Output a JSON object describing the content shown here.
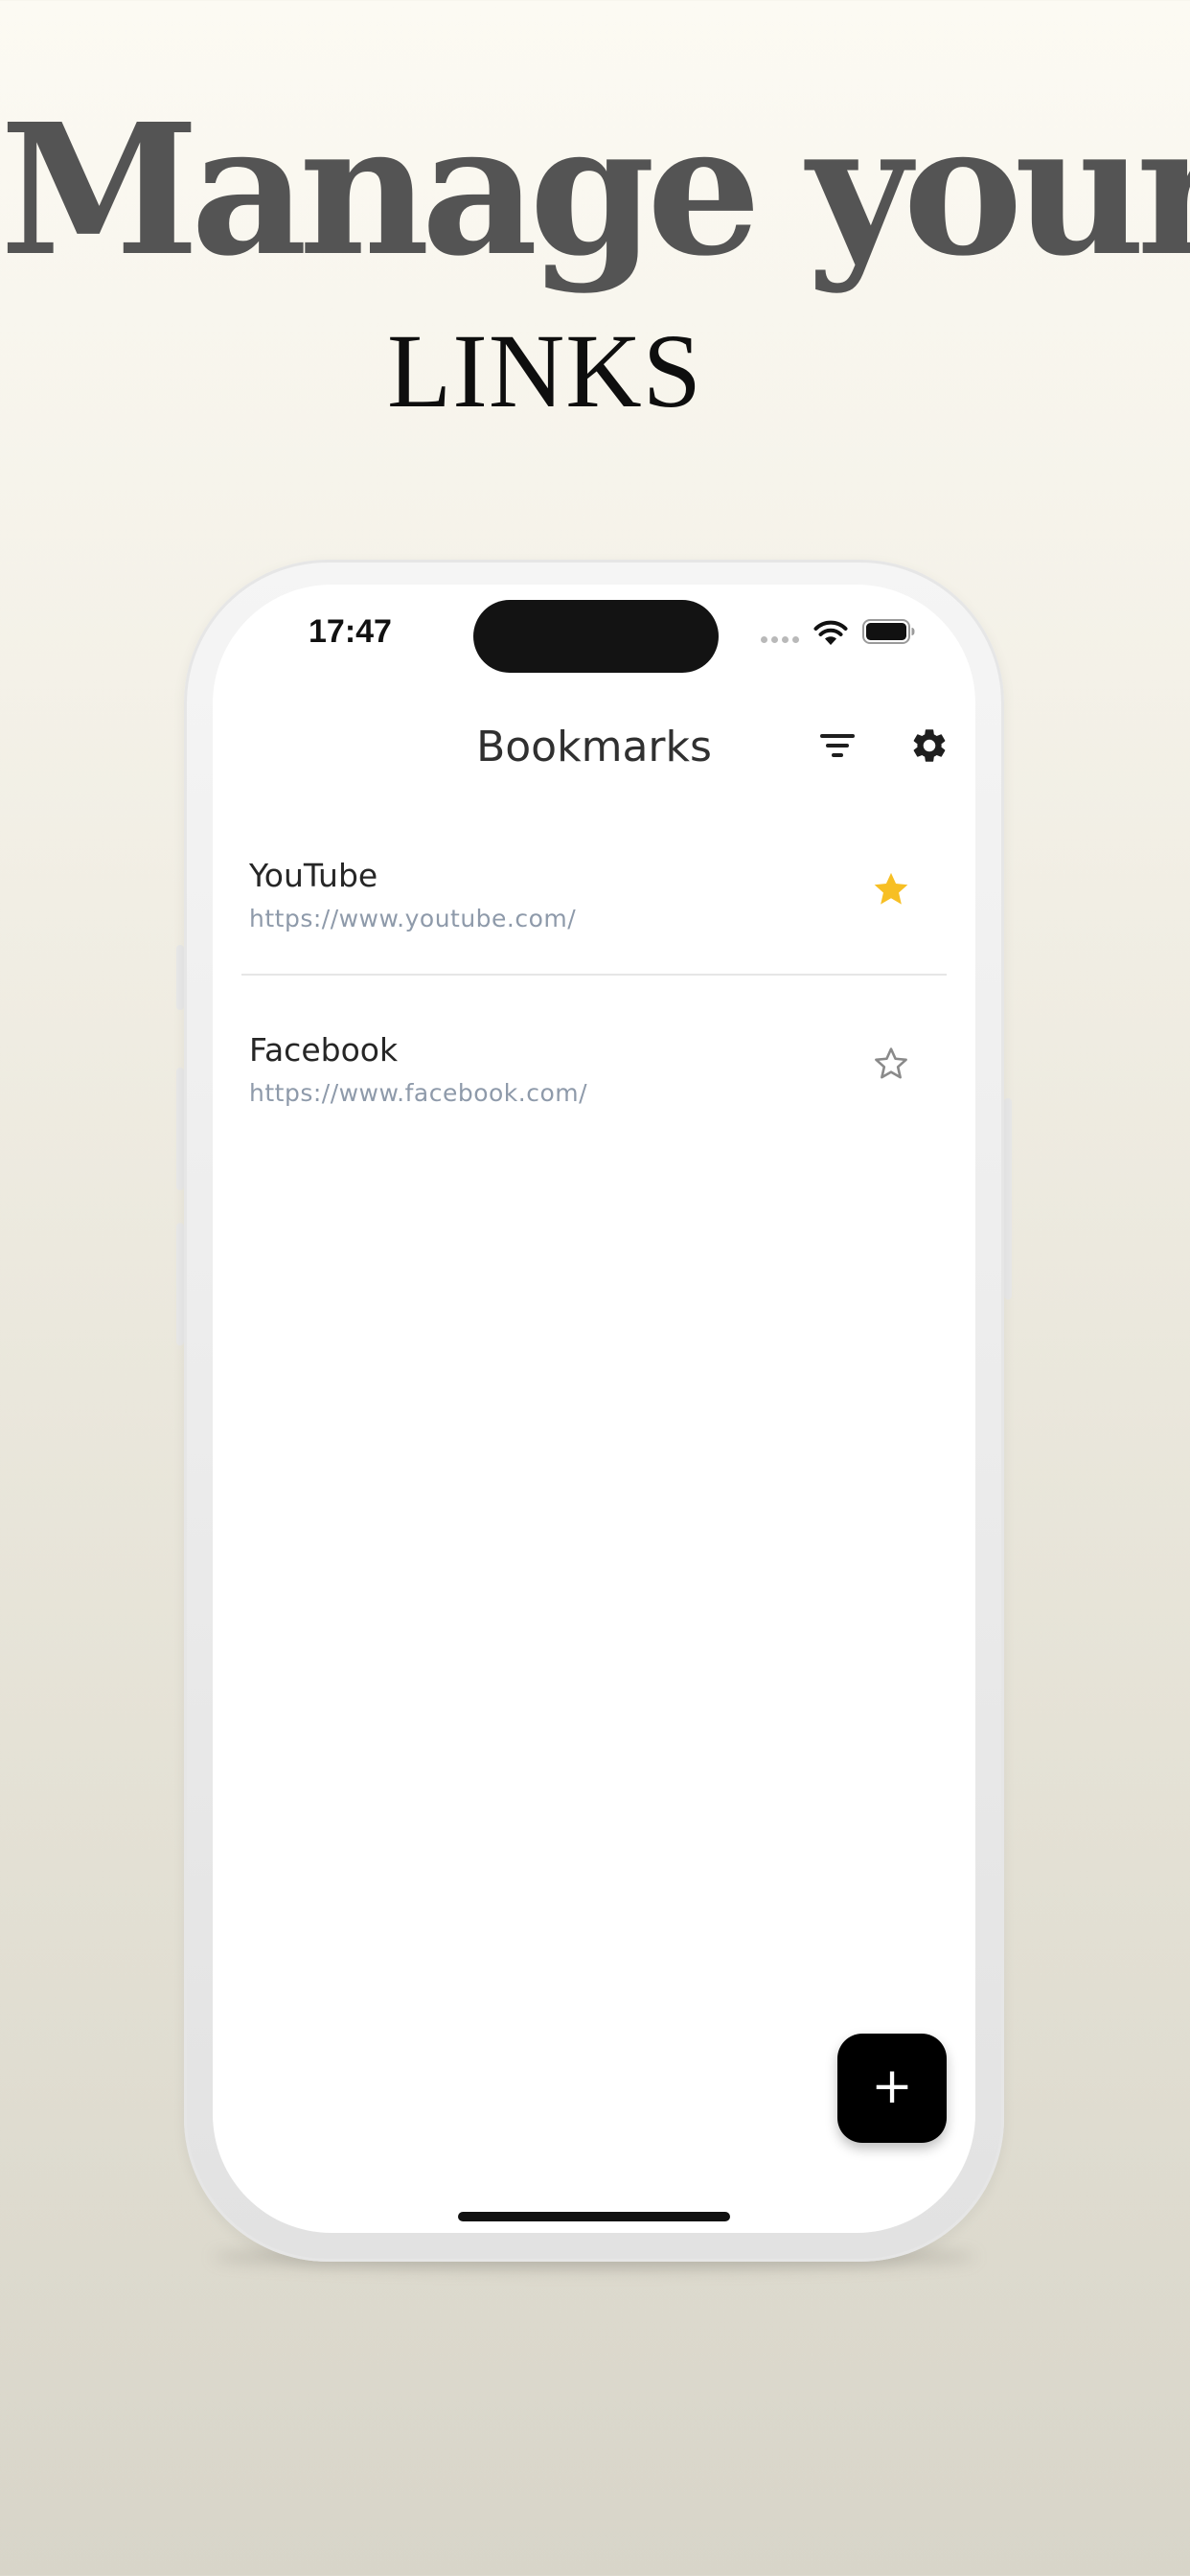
{
  "headline": {
    "main": "Manage your",
    "sub": "LINKS"
  },
  "status_bar": {
    "time": "17:47",
    "icons": [
      "signal-icon",
      "wifi-icon",
      "battery-icon"
    ]
  },
  "app_bar": {
    "title": "Bookmarks",
    "icons": [
      "filter-icon",
      "settings-gear-icon"
    ]
  },
  "bookmarks": [
    {
      "title": "YouTube",
      "url": "https://www.youtube.com/",
      "starred": true
    },
    {
      "title": "Facebook",
      "url": "https://www.facebook.com/",
      "starred": false
    }
  ],
  "fab": {
    "label": "+",
    "icon": "plus-icon"
  },
  "colors": {
    "accent_star": "#f7bf24",
    "fab_background": "#000000",
    "url_text": "#8e9aaa",
    "headline_main": "#545454"
  }
}
